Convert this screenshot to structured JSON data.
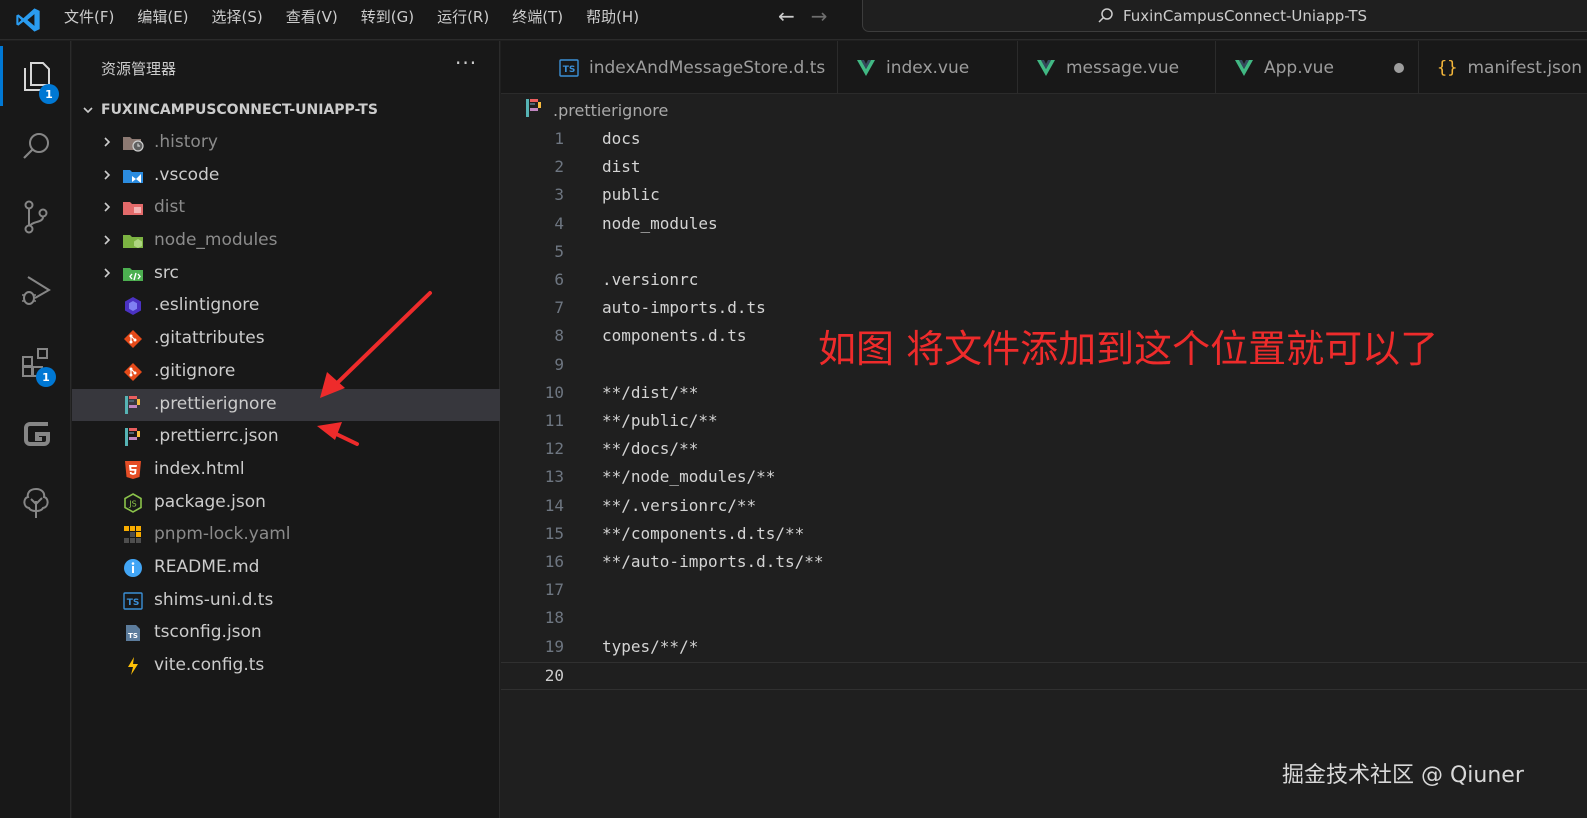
{
  "titlebar": {
    "menu": [
      "文件(F)",
      "编辑(E)",
      "选择(S)",
      "查看(V)",
      "转到(G)",
      "运行(R)",
      "终端(T)",
      "帮助(H)"
    ],
    "search_text": "FuxinCampusConnect-Uniapp-TS"
  },
  "activity": {
    "explorer_badge": "1",
    "extensions_badge": "1"
  },
  "sidebar": {
    "title": "资源管理器",
    "more": "···",
    "project": "FUXINCAMPUSCONNECT-UNIAPP-TS",
    "items": [
      {
        "label": ".history",
        "kind": "folder",
        "icon": "history-folder-icon"
      },
      {
        "label": ".vscode",
        "kind": "folder",
        "icon": "vscode-folder-icon"
      },
      {
        "label": "dist",
        "kind": "folder",
        "icon": "dist-folder-icon"
      },
      {
        "label": "node_modules",
        "kind": "folder",
        "icon": "node-modules-folder-icon"
      },
      {
        "label": "src",
        "kind": "folder",
        "icon": "src-folder-icon"
      },
      {
        "label": ".eslintignore",
        "kind": "file",
        "icon": "eslint-icon"
      },
      {
        "label": ".gitattributes",
        "kind": "file",
        "icon": "git-icon"
      },
      {
        "label": ".gitignore",
        "kind": "file",
        "icon": "git-icon"
      },
      {
        "label": ".prettierignore",
        "kind": "file",
        "icon": "prettier-icon"
      },
      {
        "label": ".prettierrc.json",
        "kind": "file",
        "icon": "prettier-icon"
      },
      {
        "label": "index.html",
        "kind": "file",
        "icon": "html5-icon"
      },
      {
        "label": "package.json",
        "kind": "file",
        "icon": "nodejs-icon"
      },
      {
        "label": "pnpm-lock.yaml",
        "kind": "file",
        "icon": "pnpm-icon"
      },
      {
        "label": "README.md",
        "kind": "file",
        "icon": "info-icon"
      },
      {
        "label": "shims-uni.d.ts",
        "kind": "file",
        "icon": "typescript-icon"
      },
      {
        "label": "tsconfig.json",
        "kind": "file",
        "icon": "tsconfig-icon"
      },
      {
        "label": "vite.config.ts",
        "kind": "file",
        "icon": "vite-icon"
      }
    ]
  },
  "tabs": [
    {
      "label": "indexAndMessageStore.d.ts",
      "icon": "typescript-icon"
    },
    {
      "label": "index.vue",
      "icon": "vue-icon"
    },
    {
      "label": "message.vue",
      "icon": "vue-icon"
    },
    {
      "label": "App.vue",
      "icon": "vue-icon"
    },
    {
      "label": "manifest.json",
      "icon": "json-icon"
    }
  ],
  "breadcrumb": ".prettierignore",
  "editor": {
    "lines": [
      "docs",
      "dist",
      "public",
      "node_modules",
      "",
      ".versionrc",
      "auto-imports.d.ts",
      "components.d.ts",
      "",
      "**/dist/**",
      "**/public/**",
      "**/docs/**",
      "**/node_modules/**",
      "**/.versionrc/**",
      "**/components.d.ts/**",
      "**/auto-imports.d.ts/**",
      "",
      "",
      "types/**/*",
      ""
    ],
    "line_numbers": [
      "1",
      "2",
      "3",
      "4",
      "5",
      "6",
      "7",
      "8",
      "9",
      "10",
      "11",
      "12",
      "13",
      "14",
      "15",
      "16",
      "17",
      "18",
      "19",
      "20"
    ],
    "current_line": "20"
  },
  "annotation": "如图 将文件添加到这个位置就可以了",
  "watermark": "掘金技术社区 @ Qiuner",
  "colors": {
    "accent": "#0078d4",
    "annotation_red": "#ee2b2b"
  }
}
